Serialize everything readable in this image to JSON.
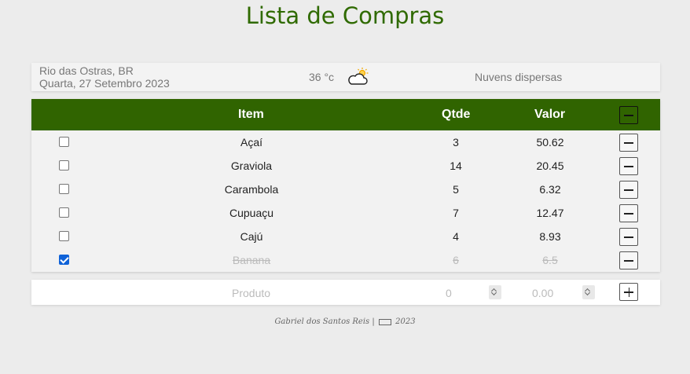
{
  "title": "Lista de Compras",
  "weather": {
    "location": "Rio das Ostras, BR",
    "date": "Quarta, 27 Setembro 2023",
    "temperature": "36 °c",
    "description": "Nuvens dispersas",
    "icon": "partly-cloudy-icon"
  },
  "table": {
    "headers": {
      "item": "Item",
      "qty": "Qtde",
      "value": "Valor"
    },
    "rows": [
      {
        "item": "Açaí",
        "qty": "3",
        "value": "50.62",
        "checked": false
      },
      {
        "item": "Graviola",
        "qty": "14",
        "value": "20.45",
        "checked": false
      },
      {
        "item": "Carambola",
        "qty": "5",
        "value": "6.32",
        "checked": false
      },
      {
        "item": "Cupuaçu",
        "qty": "7",
        "value": "12.47",
        "checked": false
      },
      {
        "item": "Cajú",
        "qty": "4",
        "value": "8.93",
        "checked": false
      },
      {
        "item": "Banana",
        "qty": "6",
        "value": "6.5",
        "checked": true
      }
    ]
  },
  "add_form": {
    "product_placeholder": "Produto",
    "qty_placeholder": "0",
    "value_placeholder": "0.00"
  },
  "footer": {
    "author": "Gabriel dos Santos Reis |",
    "year": "2023"
  },
  "colors": {
    "header_green": "#306400",
    "title_green": "#2f6a00",
    "checkbox_blue": "#0f62d8"
  }
}
